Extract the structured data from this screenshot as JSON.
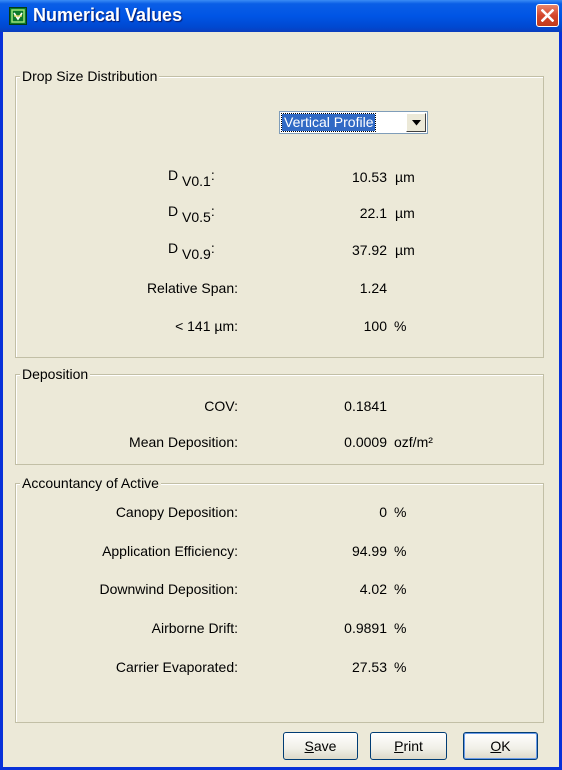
{
  "window": {
    "title": "Numerical Values",
    "title_bar_color": "#0055e5",
    "icons": {
      "app": "app-logo-icon",
      "close": "close-icon"
    }
  },
  "drop_size": {
    "legend": "Drop Size Distribution",
    "profile_select": {
      "value": "Vertical Profile",
      "icon": "chevron-down-icon"
    },
    "dv01": {
      "label_main": "D",
      "label_sub": "V0.1",
      "label_colon": ":",
      "value": "10.53",
      "unit": "µm"
    },
    "dv05": {
      "label_main": "D",
      "label_sub": "V0.5",
      "label_colon": ":",
      "value": "22.1",
      "unit": "µm"
    },
    "dv09": {
      "label_main": "D",
      "label_sub": "V0.9",
      "label_colon": ":",
      "value": "37.92",
      "unit": "µm"
    },
    "relative_span": {
      "label": "Relative Span:",
      "value": "1.24"
    },
    "fines": {
      "label": "< 141 µm:",
      "value": "100",
      "unit": "%"
    }
  },
  "deposition": {
    "legend": "Deposition",
    "cov": {
      "label": "COV:",
      "value": "0.1841"
    },
    "mean": {
      "label": "Mean Deposition:",
      "value": "0.0009",
      "unit": "ozf/m²"
    }
  },
  "accountancy": {
    "legend": "Accountancy of Active",
    "canopy": {
      "label": "Canopy Deposition:",
      "value": "0",
      "unit": "%"
    },
    "efficiency": {
      "label": "Application Efficiency:",
      "value": "94.99",
      "unit": "%"
    },
    "downwind": {
      "label": "Downwind Deposition:",
      "value": "4.02",
      "unit": "%"
    },
    "drift": {
      "label": "Airborne Drift:",
      "value": "0.9891",
      "unit": "%"
    },
    "evaporated": {
      "label": "Carrier Evaporated:",
      "value": "27.53",
      "unit": "%"
    }
  },
  "buttons": {
    "save": {
      "mnemonic": "S",
      "rest": "ave"
    },
    "print": {
      "mnemonic": "P",
      "rest": "rint"
    },
    "ok": {
      "mnemonic": "O",
      "rest": "K"
    }
  }
}
